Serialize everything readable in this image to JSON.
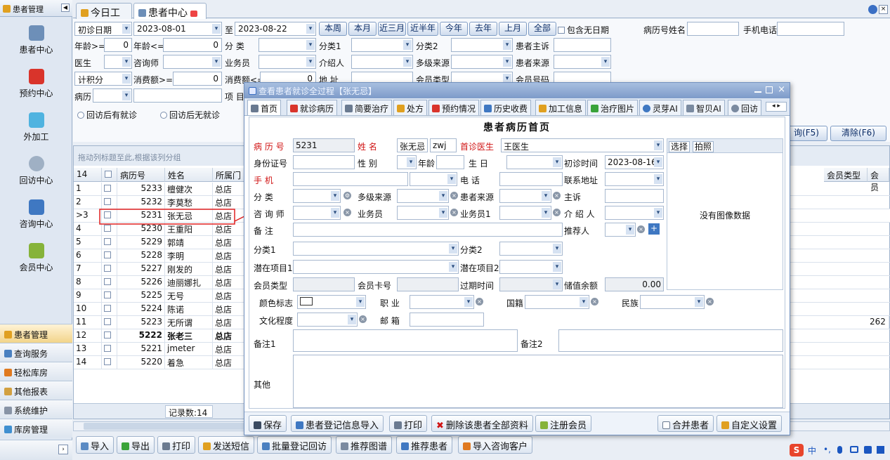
{
  "left_panel": {
    "header": "患者管理",
    "modules": [
      {
        "label": "患者中心",
        "icon": "binoculars-icon"
      },
      {
        "label": "预约中心",
        "icon": "calendar-icon"
      },
      {
        "label": "外加工",
        "icon": "cubes-icon"
      },
      {
        "label": "回访中心",
        "icon": "refresh-icon"
      },
      {
        "label": "咨询中心",
        "icon": "consultant-icon"
      },
      {
        "label": "会员中心",
        "icon": "members-icon"
      }
    ],
    "nav": [
      {
        "label": "患者管理",
        "icon": "users-icon"
      },
      {
        "label": "查询服务",
        "icon": "query-icon"
      },
      {
        "label": "轻松库房",
        "icon": "warehouse-icon"
      },
      {
        "label": "其他报表",
        "icon": "report-icon"
      },
      {
        "label": "系统维护",
        "icon": "wrench-icon"
      },
      {
        "label": "库房管理",
        "icon": "storage-icon"
      }
    ]
  },
  "tabs": [
    {
      "label": "今日工作",
      "icon": "home-icon"
    },
    {
      "label": "患者中心",
      "icon": "binoculars-icon"
    }
  ],
  "filter": {
    "date_type": "初诊日期",
    "date_from": "2023-08-01",
    "date_to_label": "至",
    "date_to": "2023-08-22",
    "quick_buttons": [
      "本周",
      "本月",
      "近三月",
      "近半年",
      "今年",
      "去年",
      "上月",
      "全部"
    ],
    "include_no_date": "包含无日期",
    "name_label": "病历号姓名",
    "phone_label": "手机电话",
    "age_ge_label": "年龄>=",
    "age_ge": "0",
    "age_le_label": "年龄<=",
    "age_le": "0",
    "fenlei_label": "分 类",
    "fenlei1_label": "分类1",
    "fenlei2_label": "分类2",
    "chief_label": "患者主诉",
    "doctor_label": "医生",
    "consultant_label": "咨询师",
    "salesman_label": "业务员",
    "introducer_label": "介绍人",
    "multi_source_label": "多级来源",
    "source_label": "患者来源",
    "points_label": "计积分",
    "spend_ge_label": "消费额>=",
    "spend_ge": "0",
    "spend_le_label": "消费额<=",
    "spend_le": "0",
    "address_label": "地 址",
    "member_type_label": "会员类型",
    "member_no_label": "会员号码",
    "record_label": "病历",
    "project_label": "项 目",
    "revisit_yes": "回访后有就诊",
    "revisit_no": "回访后无就诊",
    "query_btn": "询(F5)",
    "clear_btn": "清除(F6)"
  },
  "grid": {
    "group_hint": "拖动列标题至此,根据该列分组",
    "count": "14",
    "columns": [
      "病历号",
      "姓名",
      "所属门"
    ],
    "right_columns": [
      "会员类型",
      "会员"
    ],
    "rows": [
      {
        "n": "1",
        "id": "5233",
        "name": "檀健次",
        "store": "总店"
      },
      {
        "n": "2",
        "id": "5232",
        "name": "李莫愁",
        "store": "总店"
      },
      {
        "n": ">3",
        "id": "5231",
        "name": "张无忌",
        "store": "总店"
      },
      {
        "n": "4",
        "id": "5230",
        "name": "王重阳",
        "store": "总店"
      },
      {
        "n": "5",
        "id": "5229",
        "name": "郭靖",
        "store": "总店"
      },
      {
        "n": "6",
        "id": "5228",
        "name": "李明",
        "store": "总店"
      },
      {
        "n": "7",
        "id": "5227",
        "name": "刚发的",
        "store": "总店"
      },
      {
        "n": "8",
        "id": "5226",
        "name": "迪丽娜扎",
        "store": "总店"
      },
      {
        "n": "9",
        "id": "5225",
        "name": "无号",
        "store": "总店"
      },
      {
        "n": "10",
        "id": "5224",
        "name": "陈诺",
        "store": "总店"
      },
      {
        "n": "11",
        "id": "5223",
        "name": "无所谓",
        "store": "总店"
      },
      {
        "n": "12",
        "id": "5222",
        "name": "张老三",
        "store": "总店"
      },
      {
        "n": "13",
        "id": "5221",
        "name": "jmeter",
        "store": "总店"
      },
      {
        "n": "14",
        "id": "5220",
        "name": "着急",
        "store": "总店"
      }
    ],
    "row11_extra": "262",
    "record_count": "记录数:14"
  },
  "bottom_toolbar": [
    "导入",
    "导出",
    "打印",
    "发送短信",
    "批量登记回访",
    "推荐图谱",
    "推荐患者",
    "导入咨询客户"
  ],
  "dialog": {
    "title": "查看患者就诊全过程【张无忌】",
    "tabs": [
      "首页",
      "就诊病历",
      "简要治疗",
      "处方",
      "预约情况",
      "历史收费",
      "加工信息",
      "治疗图片",
      "灵芽AI",
      "智贝AI",
      "回访"
    ],
    "form_title": "患者病历首页",
    "labels": {
      "record_no": "病 历 号",
      "name": "姓 名",
      "first_doctor": "首诊医生",
      "id_card": "身份证号",
      "gender": "性 别",
      "age": "年龄",
      "birthday": "生 日",
      "first_time": "初诊时间",
      "mobile": "手 机",
      "phone": "电 话",
      "address": "联系地址",
      "category": "分 类",
      "multi_source": "多级来源",
      "source": "患者来源",
      "chief": "主诉",
      "consultant": "咨 询 师",
      "salesman": "业务员",
      "salesman1": "业务员1",
      "introducer": "介 绍 人",
      "remark": "备 注",
      "recommender": "推荐人",
      "cat1": "分类1",
      "cat2": "分类2",
      "potential1": "潜在项目1",
      "potential2": "潜在项目2",
      "member_type": "会员类型",
      "member_card": "会员卡号",
      "expire": "过期时间",
      "balance": "储值余额",
      "color_tag": "颜色标志",
      "job": "职 业",
      "nationality": "国籍",
      "ethnic": "民族",
      "education": "文化程度",
      "email": "邮 箱",
      "remark1": "备注1",
      "remark2": "备注2",
      "other": "其他"
    },
    "values": {
      "record_no": "5231",
      "name": "张无忌",
      "pinyin": "zwj",
      "first_doctor": "王医生",
      "first_time": "2023-08-16",
      "balance": "0.00"
    },
    "photo_buttons": [
      "选择",
      "拍照"
    ],
    "no_image": "没有图像数据",
    "buttons": [
      "保存",
      "患者登记信息导入",
      "打印",
      "删除该患者全部资料",
      "注册会员",
      "合并患者",
      "自定义设置"
    ]
  }
}
